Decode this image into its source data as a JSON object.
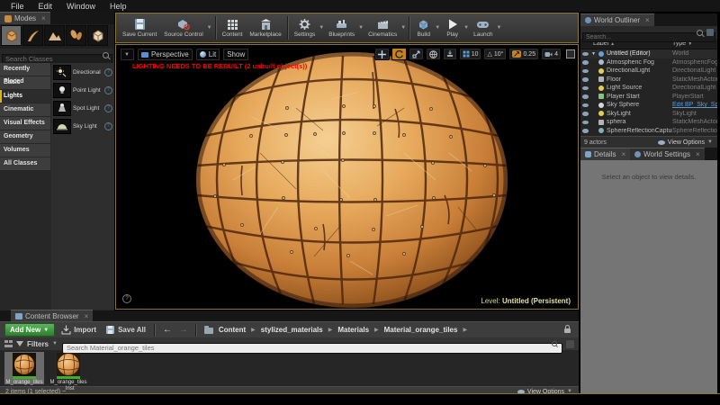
{
  "menu_bar": {
    "items": [
      "File",
      "Edit",
      "Window",
      "Help"
    ]
  },
  "modes_panel": {
    "tab_label": "Modes",
    "search_placeholder": "Search Classes",
    "categories": [
      "Recently Placed",
      "Basic",
      "Lights",
      "Cinematic",
      "Visual Effects",
      "Geometry",
      "Volumes",
      "All Classes"
    ],
    "selected_category": "Lights",
    "placeables": [
      "Directional Light",
      "Point Light",
      "Spot Light",
      "Sky Light"
    ]
  },
  "main_toolbar": {
    "buttons": [
      "Save Current",
      "Source Control",
      "Content",
      "Marketplace",
      "Settings",
      "Blueprints",
      "Cinematics",
      "Build",
      "Play",
      "Launch"
    ]
  },
  "viewport": {
    "view_buttons": {
      "perspective": "Perspective",
      "lit": "Lit",
      "show": "Show"
    },
    "warning": "LIGHTING NEEDS TO BE REBUILT (2 unbuilt object(s))",
    "snap": {
      "grid_size": "10",
      "rotation_angle": "10°",
      "scale_value": "0.25",
      "camera_speed": "4"
    },
    "level_label": "Level:",
    "level_value": "Untitled (Persistent)"
  },
  "world_outliner": {
    "tab_label": "World Outliner",
    "search_placeholder": "Search...",
    "columns": {
      "label": "Label",
      "type": "Type"
    },
    "rows": [
      {
        "label": "Untitled (Editor)",
        "type": "World"
      },
      {
        "label": "Atmospheric Fog",
        "type": "AtmosphericFog"
      },
      {
        "label": "DirectionalLight",
        "type": "DirectionalLight"
      },
      {
        "label": "Floor",
        "type": "StaticMeshActor"
      },
      {
        "label": "Light Source",
        "type": "DirectionalLight"
      },
      {
        "label": "Player Start",
        "type": "PlayerStart"
      },
      {
        "label": "Sky Sphere",
        "type": "Edit BP_Sky_Sph"
      },
      {
        "label": "SkyLight",
        "type": "SkyLight"
      },
      {
        "label": "sphera",
        "type": "StaticMeshActor"
      },
      {
        "label": "SphereReflectionCapture",
        "type": "SphereReflectionC"
      }
    ],
    "footer": {
      "actor_count": "9 actors",
      "view_options": "View Options"
    }
  },
  "details_panel": {
    "tabs": {
      "details": "Details",
      "world_settings": "World Settings"
    },
    "empty_message": "Select an object to view details."
  },
  "content_browser": {
    "tab_label": "Content Browser",
    "add_new_label": "Add New",
    "import_label": "Import",
    "save_all_label": "Save All",
    "breadcrumbs": [
      "Content",
      "stylized_materials",
      "Materials",
      "Material_orange_tiles"
    ],
    "filters_label": "Filters",
    "search_placeholder": "Search Material_orange_tiles",
    "assets": [
      {
        "name": "M_orange_tiles",
        "selected": true
      },
      {
        "name": "M_orange_tiles_Inst",
        "selected": false
      }
    ],
    "status_text": "2 items (1 selected)",
    "view_options": "View Options"
  },
  "colors": {
    "focus_border": "#8a7634",
    "selection_orange": "#c8811f",
    "warning_red": "#fe0000",
    "add_new_green": "#3f9b3f",
    "link_blue": "#5d9bd4",
    "material_bar_green": "#3fae2a"
  }
}
